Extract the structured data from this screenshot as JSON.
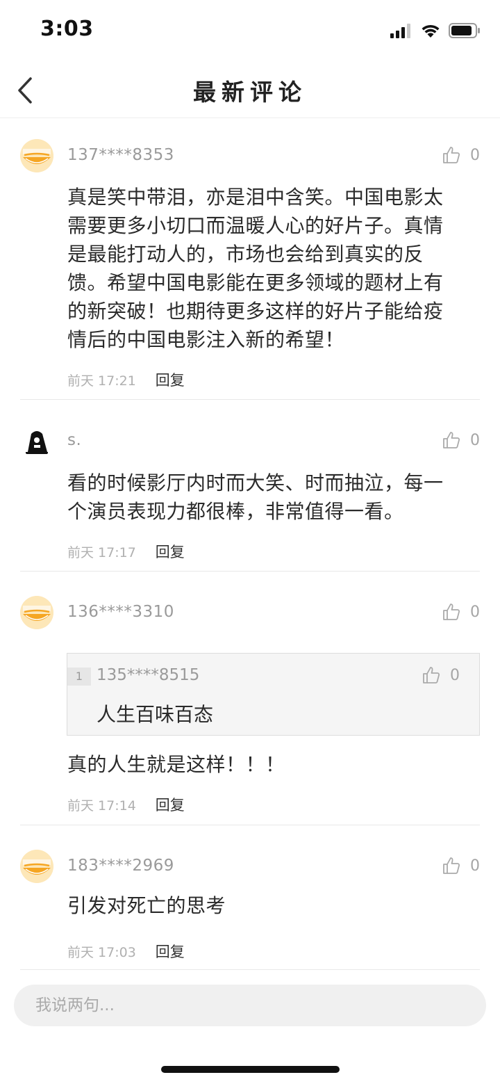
{
  "status_bar": {
    "time": "3:03"
  },
  "nav": {
    "title": "最新评论"
  },
  "comments": [
    {
      "avatar": "the-hour-news-logo",
      "username": "137****8353",
      "likes": "0",
      "content": "真是笑中带泪，亦是泪中含笑。中国电影太需要更多小切口而温暖人心的好片子。真情是最能打动人的，市场也会给到真实的反馈。希望中国电影能在更多领域的题材上有的新突破！也期待更多这样的好片子能给疫情后的中国电影注入新的希望！",
      "time": "前天 17:21",
      "reply_label": "回复"
    },
    {
      "avatar": "black-character-avatar",
      "username": "s.",
      "likes": "0",
      "content": "看的时候影厅内时而大笑、时而抽泣，每一个演员表现力都很棒，非常值得一看。",
      "time": "前天 17:17",
      "reply_label": "回复"
    },
    {
      "avatar": "the-hour-news-logo",
      "username": "136****3310",
      "likes": "0",
      "quote": {
        "index": "1",
        "username": "135****8515",
        "likes": "0",
        "text": "人生百味百态"
      },
      "content": "真的人生就是这样！！！",
      "time": "前天 17:14",
      "reply_label": "回复"
    },
    {
      "avatar": "the-hour-news-logo",
      "username": "183****2969",
      "likes": "0",
      "content": "引发对死亡的思考",
      "time": "前天 17:03",
      "reply_label": "回复"
    }
  ],
  "input": {
    "placeholder": "我说两句..."
  },
  "colors": {
    "background": "#ffffff",
    "text": "#2a2a2a",
    "muted": "#9a9a9a",
    "input_bg": "#f0f0f0"
  }
}
